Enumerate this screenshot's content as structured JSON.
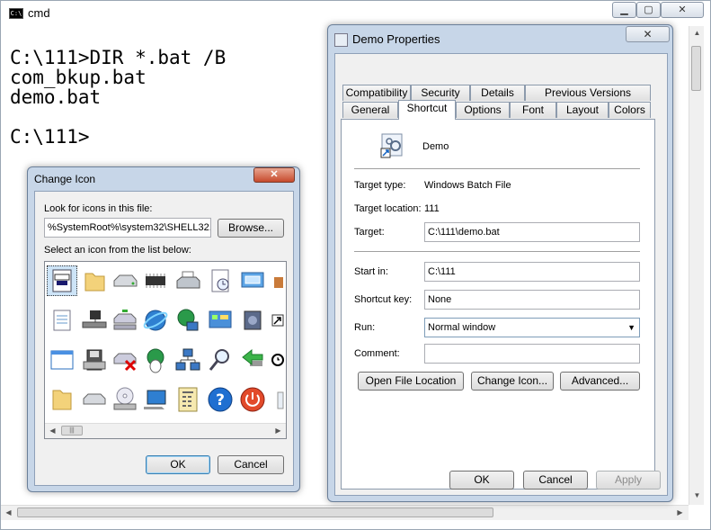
{
  "cmd": {
    "title": "cmd",
    "lines": [
      "C:\\111>DIR *.bat /B",
      "com_bkup.bat",
      "demo.bat",
      "",
      "C:\\111>"
    ],
    "caption_icons": {
      "minimize": "minimize-icon",
      "maximize": "maximize-icon",
      "close": "close-icon"
    }
  },
  "properties": {
    "title": "Demo Properties",
    "tabs_row1": [
      "Compatibility",
      "Security",
      "Details",
      "Previous Versions"
    ],
    "tabs_row2": [
      "General",
      "Shortcut",
      "Options",
      "Font",
      "Layout",
      "Colors"
    ],
    "active_tab": "Shortcut",
    "name": "Demo",
    "target_type_label": "Target type:",
    "target_type": "Windows Batch File",
    "target_location_label": "Target location:",
    "target_location": "111",
    "target_label": "Target:",
    "target": "C:\\111\\demo.bat",
    "start_in_label": "Start in:",
    "start_in": "C:\\111",
    "shortcut_key_label": "Shortcut key:",
    "shortcut_key": "None",
    "run_label": "Run:",
    "run": "Normal window",
    "comment_label": "Comment:",
    "comment": "",
    "btn_open_location": "Open File Location",
    "btn_change_icon": "Change Icon...",
    "btn_advanced": "Advanced...",
    "btn_ok": "OK",
    "btn_cancel": "Cancel",
    "btn_apply": "Apply"
  },
  "change_icon": {
    "title": "Change Icon",
    "look_label": "Look for icons in this file:",
    "file": "%SystemRoot%\\system32\\SHELL32.dll",
    "browse": "Browse...",
    "list_label": "Select an icon from the list below:",
    "icons": [
      "batch-file-icon",
      "folder-icon",
      "drive-icon",
      "chip-icon",
      "printer-icon",
      "clock-document-icon",
      "display-icon",
      "partial-icon",
      "text-document-icon",
      "network-drive-icon",
      "server-drive-icon",
      "internet-globe-icon",
      "network-globe-icon",
      "control-panel-icon",
      "speaker-icon",
      "shortcut-arrow-icon",
      "window-icon",
      "floppy-icon",
      "removed-drive-icon",
      "mouse-globe-icon",
      "network-computers-icon",
      "search-icon",
      "back-arrow-icon",
      "clock-icon",
      "open-folder-icon",
      "disk-drive-icon",
      "cd-drive-icon",
      "computer-icon",
      "calculator-icon",
      "help-icon",
      "power-icon",
      "partial-icon-2"
    ],
    "ok": "OK",
    "cancel": "Cancel"
  }
}
